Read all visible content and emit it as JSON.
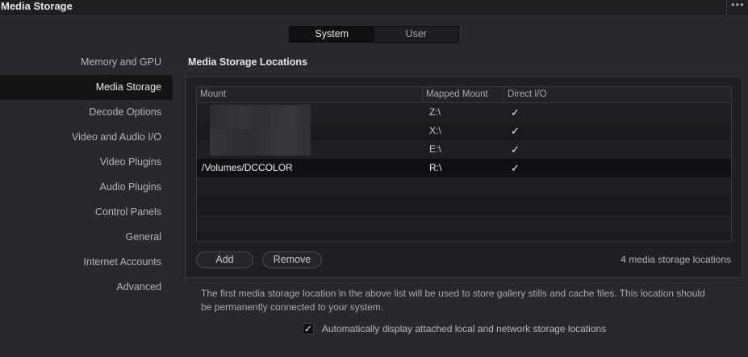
{
  "window": {
    "title": "Media Storage",
    "more_icon": "ellipsis-icon"
  },
  "tabs": [
    {
      "label": "System",
      "active": true
    },
    {
      "label": "User",
      "active": false
    }
  ],
  "sidebar": {
    "items": [
      {
        "label": "Memory and GPU",
        "active": false
      },
      {
        "label": "Media Storage",
        "active": true
      },
      {
        "label": "Decode Options",
        "active": false
      },
      {
        "label": "Video and Audio I/O",
        "active": false
      },
      {
        "label": "Video Plugins",
        "active": false
      },
      {
        "label": "Audio Plugins",
        "active": false
      },
      {
        "label": "Control Panels",
        "active": false
      },
      {
        "label": "General",
        "active": false
      },
      {
        "label": "Internet Accounts",
        "active": false
      },
      {
        "label": "Advanced",
        "active": false
      }
    ]
  },
  "main": {
    "section_title": "Media Storage Locations",
    "table": {
      "columns": [
        "Mount",
        "Mapped Mount",
        "Direct I/O"
      ],
      "rows": [
        {
          "mount": "",
          "mapped": "Z:\\",
          "direct_io": "✓"
        },
        {
          "mount": "",
          "mapped": "X:\\",
          "direct_io": "✓"
        },
        {
          "mount": "",
          "mapped": "E:\\",
          "direct_io": "✓"
        },
        {
          "mount": "/Volumes/DCCOLOR",
          "mapped": "R:\\",
          "direct_io": "✓",
          "selected": true
        }
      ]
    },
    "buttons": {
      "add": "Add",
      "remove": "Remove"
    },
    "count_label": "4 media storage locations",
    "note": "The first media storage location in the above list will be used to store gallery stills and cache files. This location should be permanently connected to your system.",
    "auto_display": {
      "checked": "✓",
      "label": "Automatically display attached local and network storage locations"
    }
  }
}
